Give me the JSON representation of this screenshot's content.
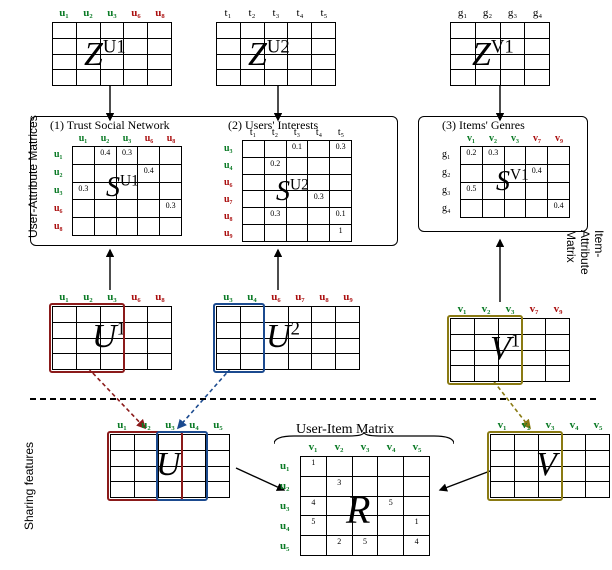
{
  "ZU1": {
    "cols": [
      "u1",
      "u2",
      "u3",
      "u6",
      "u8"
    ],
    "col_colors": [
      "green",
      "green",
      "green",
      "red",
      "red"
    ],
    "symbol": "Z",
    "sup": "U1"
  },
  "ZU2": {
    "cols": [
      "t1",
      "t2",
      "t3",
      "t4",
      "t5"
    ],
    "col_colors": [
      "black",
      "black",
      "black",
      "black",
      "black"
    ],
    "symbol": "Z",
    "sup": "U2"
  },
  "ZV1": {
    "cols": [
      "g1",
      "g2",
      "g3",
      "g4"
    ],
    "col_colors": [
      "black",
      "black",
      "black",
      "black"
    ],
    "symbol": "Z",
    "sup": "V1"
  },
  "captions": {
    "trust": "(1) Trust Social Network",
    "interests": "(2) Users' Interests",
    "genres": "(3) Items' Genres",
    "user_item": "User-Item Matrix",
    "user_attr": "User-Attribute\nMatrices",
    "item_attr": "Item-Attribute\nMatrix",
    "sharing": "Sharing features"
  },
  "SU1": {
    "cols": [
      "u1",
      "u2",
      "u3",
      "u6",
      "u8"
    ],
    "rows": [
      "u1",
      "u2",
      "u3",
      "u6",
      "u8"
    ],
    "col_colors": [
      "green",
      "green",
      "green",
      "red",
      "red"
    ],
    "row_colors": [
      "green",
      "green",
      "green",
      "red",
      "red"
    ],
    "cells": [
      [
        "",
        "0.4",
        "0.3",
        "",
        ""
      ],
      [
        "",
        "",
        "",
        "0.4",
        ""
      ],
      [
        "0.3",
        "",
        "",
        "",
        ""
      ],
      [
        "",
        "",
        "",
        "",
        "0.3"
      ],
      [
        "",
        "",
        "",
        "",
        ""
      ]
    ],
    "symbol": "S",
    "sup": "U1"
  },
  "SU2": {
    "cols": [
      "t1",
      "t2",
      "t3",
      "t4",
      "t5"
    ],
    "rows": [
      "u3",
      "u4",
      "u6",
      "u7",
      "u8",
      "u9"
    ],
    "col_colors": [
      "black",
      "black",
      "black",
      "black",
      "black"
    ],
    "row_colors": [
      "green",
      "green",
      "red",
      "red",
      "red",
      "red"
    ],
    "cells": [
      [
        "",
        "",
        "0.1",
        "",
        "0.3"
      ],
      [
        "",
        "0.2",
        "",
        "",
        ""
      ],
      [
        "",
        "",
        "",
        "",
        ""
      ],
      [
        "",
        "",
        "",
        "0.3",
        ""
      ],
      [
        "",
        "0.3",
        "",
        "",
        "0.1"
      ],
      [
        "",
        "",
        "",
        "",
        "1"
      ]
    ],
    "symbol": "S",
    "sup": "U2"
  },
  "SV1": {
    "cols": [
      "v1",
      "v2",
      "v3",
      "v7",
      "v9"
    ],
    "rows": [
      "g1",
      "g2",
      "g3",
      "g4"
    ],
    "col_colors": [
      "green",
      "green",
      "green",
      "red",
      "red"
    ],
    "row_colors": [
      "black",
      "black",
      "black",
      "black"
    ],
    "cells": [
      [
        "0.2",
        "0.3",
        "",
        "",
        ""
      ],
      [
        "",
        "",
        "",
        "0.4",
        ""
      ],
      [
        "0.5",
        "",
        "",
        "",
        ""
      ],
      [
        "",
        "",
        "",
        "",
        "0.4"
      ]
    ],
    "symbol": "S",
    "sup": "V1"
  },
  "U1_": {
    "cols": [
      "u1",
      "u2",
      "u3",
      "u6",
      "u8"
    ],
    "col_colors": [
      "green",
      "green",
      "green",
      "red",
      "red"
    ],
    "symbol": "U",
    "sup": "1"
  },
  "U2_": {
    "cols": [
      "u3",
      "u4",
      "u6",
      "u7",
      "u8",
      "u9"
    ],
    "col_colors": [
      "green",
      "green",
      "red",
      "red",
      "red",
      "red"
    ],
    "symbol": "U",
    "sup": "2"
  },
  "V1_": {
    "cols": [
      "v1",
      "v2",
      "v3",
      "v7",
      "v9"
    ],
    "col_colors": [
      "green",
      "green",
      "green",
      "red",
      "red"
    ],
    "symbol": "V",
    "sup": "1"
  },
  "U_": {
    "cols": [
      "u1",
      "u2",
      "u3",
      "u4",
      "u5"
    ],
    "col_colors": [
      "green",
      "green",
      "green",
      "green",
      "green"
    ],
    "symbol": "U",
    "sup": ""
  },
  "V_": {
    "cols": [
      "v1",
      "v2",
      "v3",
      "v4",
      "v5"
    ],
    "col_colors": [
      "green",
      "green",
      "green",
      "green",
      "green"
    ],
    "symbol": "V",
    "sup": ""
  },
  "R_": {
    "cols": [
      "v1",
      "v2",
      "v3",
      "v4",
      "v5"
    ],
    "rows": [
      "u1",
      "u2",
      "u3",
      "u4",
      "u5"
    ],
    "col_colors": [
      "green",
      "green",
      "green",
      "green",
      "green"
    ],
    "row_colors": [
      "green",
      "green",
      "green",
      "green",
      "green"
    ],
    "cells": [
      [
        "1",
        "",
        "",
        "",
        ""
      ],
      [
        "",
        "3",
        "",
        "",
        ""
      ],
      [
        "4",
        "",
        "",
        "5",
        ""
      ],
      [
        "5",
        "",
        "",
        "",
        "1"
      ],
      [
        "",
        "2",
        "5",
        "",
        "4"
      ]
    ],
    "symbol": "R",
    "sup": ""
  },
  "chart_data": [
    {
      "name": "Z^{U1}",
      "type": "table",
      "grid_rows": 4,
      "columns": [
        "u1",
        "u2",
        "u3",
        "u6",
        "u8"
      ]
    },
    {
      "name": "Z^{U2}",
      "type": "table",
      "grid_rows": 4,
      "columns": [
        "t1",
        "t2",
        "t3",
        "t4",
        "t5"
      ]
    },
    {
      "name": "Z^{V1}",
      "type": "table",
      "grid_rows": 4,
      "columns": [
        "g1",
        "g2",
        "g3",
        "g4"
      ]
    },
    {
      "name": "S^{U1}",
      "type": "heatmap",
      "rows": [
        "u1",
        "u2",
        "u3",
        "u6",
        "u8"
      ],
      "columns": [
        "u1",
        "u2",
        "u3",
        "u6",
        "u8"
      ],
      "values": [
        [
          null,
          0.4,
          0.3,
          null,
          null
        ],
        [
          null,
          null,
          null,
          0.4,
          null
        ],
        [
          0.3,
          null,
          null,
          null,
          null
        ],
        [
          null,
          null,
          null,
          null,
          0.3
        ],
        [
          null,
          null,
          null,
          null,
          null
        ]
      ]
    },
    {
      "name": "S^{U2}",
      "type": "heatmap",
      "rows": [
        "u3",
        "u4",
        "u6",
        "u7",
        "u8",
        "u9"
      ],
      "columns": [
        "t1",
        "t2",
        "t3",
        "t4",
        "t5"
      ],
      "values": [
        [
          null,
          null,
          0.1,
          null,
          0.3
        ],
        [
          null,
          0.2,
          null,
          null,
          null
        ],
        [
          null,
          null,
          null,
          null,
          null
        ],
        [
          null,
          null,
          null,
          0.3,
          null
        ],
        [
          null,
          0.3,
          null,
          null,
          0.1
        ],
        [
          null,
          null,
          null,
          null,
          1
        ]
      ]
    },
    {
      "name": "S^{V1}",
      "type": "heatmap",
      "rows": [
        "g1",
        "g2",
        "g3",
        "g4"
      ],
      "columns": [
        "v1",
        "v2",
        "v3",
        "v7",
        "v9"
      ],
      "values": [
        [
          0.2,
          0.3,
          null,
          null,
          null
        ],
        [
          null,
          null,
          null,
          0.4,
          null
        ],
        [
          0.5,
          null,
          null,
          null,
          null
        ],
        [
          null,
          null,
          null,
          null,
          0.4
        ]
      ]
    },
    {
      "name": "U^{1}",
      "type": "table",
      "grid_rows": 4,
      "columns": [
        "u1",
        "u2",
        "u3",
        "u6",
        "u8"
      ]
    },
    {
      "name": "U^{2}",
      "type": "table",
      "grid_rows": 4,
      "columns": [
        "u3",
        "u4",
        "u6",
        "u7",
        "u8",
        "u9"
      ]
    },
    {
      "name": "V^{1}",
      "type": "table",
      "grid_rows": 4,
      "columns": [
        "v1",
        "v2",
        "v3",
        "v7",
        "v9"
      ]
    },
    {
      "name": "U",
      "type": "table",
      "grid_rows": 4,
      "columns": [
        "u1",
        "u2",
        "u3",
        "u4",
        "u5"
      ]
    },
    {
      "name": "V",
      "type": "table",
      "grid_rows": 4,
      "columns": [
        "v1",
        "v2",
        "v3",
        "v4",
        "v5"
      ]
    },
    {
      "name": "R",
      "type": "heatmap",
      "rows": [
        "u1",
        "u2",
        "u3",
        "u4",
        "u5"
      ],
      "columns": [
        "v1",
        "v2",
        "v3",
        "v4",
        "v5"
      ],
      "values": [
        [
          1,
          null,
          null,
          null,
          null
        ],
        [
          null,
          3,
          null,
          null,
          null
        ],
        [
          4,
          null,
          null,
          5,
          null
        ],
        [
          5,
          null,
          null,
          null,
          1
        ],
        [
          null,
          2,
          5,
          null,
          4
        ]
      ]
    }
  ]
}
